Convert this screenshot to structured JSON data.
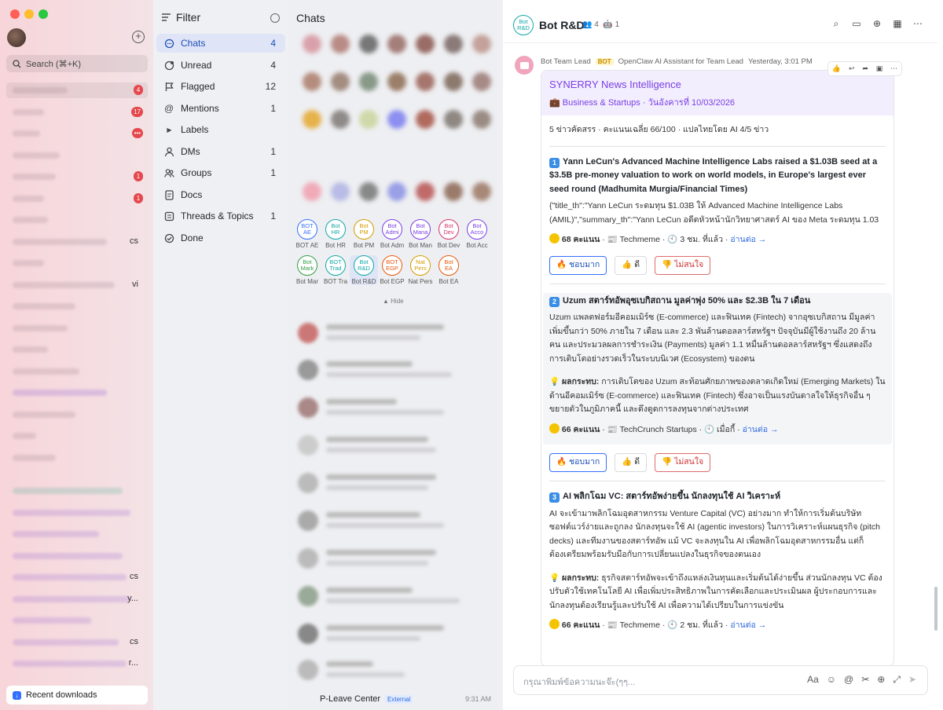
{
  "window": {
    "controls": [
      "close",
      "minimize",
      "zoom"
    ]
  },
  "sidebar": {
    "search_placeholder": "Search (⌘+K)",
    "badges": [
      "4",
      "17",
      "•••",
      "1",
      "1"
    ],
    "truncated_tails": [
      "cs",
      "vi",
      "cs",
      "cs",
      "y...",
      "cs",
      "r..."
    ],
    "recent_downloads": "Recent downloads"
  },
  "filter": {
    "title": "Filter",
    "items": [
      {
        "label": "Chats",
        "count": "4",
        "icon": "chat-bubble-icon"
      },
      {
        "label": "Unread",
        "count": "4",
        "icon": "unread-icon"
      },
      {
        "label": "Flagged",
        "count": "12",
        "icon": "flag-icon"
      },
      {
        "label": "Mentions",
        "count": "1",
        "icon": "at-icon"
      },
      {
        "label": "Labels",
        "count": "",
        "icon": "caret-right-icon"
      },
      {
        "label": "DMs",
        "count": "1",
        "icon": "person-icon"
      },
      {
        "label": "Groups",
        "count": "1",
        "icon": "group-icon"
      },
      {
        "label": "Docs",
        "count": "",
        "icon": "doc-icon"
      },
      {
        "label": "Threads & Topics",
        "count": "1",
        "icon": "threads-icon"
      },
      {
        "label": "Done",
        "count": "",
        "icon": "check-icon"
      }
    ]
  },
  "chats": {
    "title": "Chats",
    "bots": [
      {
        "avatar": [
          "BOT",
          "AE"
        ],
        "name": "BOT AE",
        "color": "#3370ff"
      },
      {
        "avatar": [
          "Bot",
          "HR"
        ],
        "name": "Bot HR",
        "color": "#13a8a8"
      },
      {
        "avatar": [
          "Bot",
          "PM"
        ],
        "name": "Bot PM",
        "color": "#d49b00"
      },
      {
        "avatar": [
          "Bot",
          "Admi"
        ],
        "name": "Bot Adm",
        "color": "#7b3fe4"
      },
      {
        "avatar": [
          "Bot",
          "Mana"
        ],
        "name": "Bot Man",
        "color": "#7b3fe4"
      },
      {
        "avatar": [
          "Bot",
          "Dev"
        ],
        "name": "Bot Dev",
        "color": "#d6336c"
      },
      {
        "avatar": [
          "Bot",
          "Acco"
        ],
        "name": "Bot Acc",
        "color": "#7b3fe4"
      },
      {
        "avatar": [
          "Bot",
          "Mark"
        ],
        "name": "Bot Mar",
        "color": "#2f9e44"
      },
      {
        "avatar": [
          "BOT",
          "Trad"
        ],
        "name": "BOT Tra",
        "color": "#13a8a8"
      },
      {
        "avatar": [
          "Bot",
          "R&D"
        ],
        "name": "Bot R&D",
        "color": "#13a8a8"
      },
      {
        "avatar": [
          "BOT",
          "EGP"
        ],
        "name": "Bot EGP",
        "color": "#e8590c"
      },
      {
        "avatar": [
          "Nat",
          "Pers"
        ],
        "name": "Nat Pers",
        "color": "#d49b00"
      },
      {
        "avatar": [
          "Bot",
          "EA"
        ],
        "name": "Bot EA",
        "color": "#e8590c"
      }
    ],
    "hide_label": "Hide",
    "last_row": {
      "name": "P-Leave Center",
      "tag": "External",
      "time": "9:31 AM"
    }
  },
  "conversation": {
    "avatar": [
      "Bot",
      "R&D"
    ],
    "title": "Bot R&D",
    "members": "4",
    "bots_count": "1",
    "message": {
      "sender": "Bot Team Lead",
      "sender_tag": "BOT",
      "sender_desc": "OpenClaw AI Assistant for Team Lead",
      "time": "Yesterday, 3:01 PM",
      "card_title": "SYNERRY News Intelligence",
      "card_subtitle": "💼 Business & Startups · วันอังคารที่ 10/03/2026",
      "summary": "5 ข่าวคัดสรร · คะแนนเฉลี่ย 66/100 · แปลไทยโดย AI 4/5 ข่าว",
      "items": [
        {
          "num": "1",
          "headline": "Yann LeCun's Advanced Machine Intelligence Labs raised a $1.03B seed at a $3.5B pre-money valuation to work on world models, in Europe's largest ever seed round (Madhumita Murgia/Financial Times)",
          "body": "{\"title_th\":\"Yann LeCun ระดมทุน $1.03B ให้ Advanced Machine Intelligence Labs (AMIL)\",\"summary_th\":\"Yann LeCun อดีตหัวหน้านักวิทยาศาสตร์ AI ของ Meta ระดมทุน 1.03",
          "impact": "",
          "score": "68 คะแนน",
          "source": "📰 Techmeme",
          "when": "🕙 3 ชม. ที่แล้ว",
          "link": "อ่านต่อ →"
        },
        {
          "num": "2",
          "headline": "Uzum สตาร์ทอัพอุซเบกิสถาน มูลค่าพุ่ง 50% และ $2.3B ใน 7 เดือน",
          "body": "Uzum แพลตฟอร์มอีคอมเมิร์ซ (E-commerce) และฟินเทค (Fintech) จากอุซเบกิสถาน มีมูลค่าเพิ่มขึ้นกว่า 50% ภายใน 7 เดือน และ 2.3 พันล้านดอลลาร์สหรัฐฯ ปัจจุบันมีผู้ใช้งานถึง 20 ล้านคน และประมวลผลการชำระเงิน (Payments) มูลค่า 1.1 หมื่นล้านดอลลาร์สหรัฐฯ ซึ่งแสดงถึงการเติบโตอย่างรวดเร็วในระบบนิเวศ (Ecosystem) ของตน",
          "impact_label": "ผลกระทบ:",
          "impact": "การเติบโตของ Uzum สะท้อนศักยภาพของตลาดเกิดใหม่ (Emerging Markets) ในด้านอีคอมเมิร์ซ (E-commerce) และฟินเทค (Fintech) ซึ่งอาจเป็นแรงบันดาลใจให้ธุรกิจอื่น ๆ ขยายตัวในภูมิภาคนี้ และดึงดูดการลงทุนจากต่างประเทศ",
          "score": "66 คะแนน",
          "source": "📰 TechCrunch Startups",
          "when": "🕙 เมื่อกี้",
          "link": "อ่านต่อ →"
        },
        {
          "num": "3",
          "headline": "AI พลิกโฉม VC: สตาร์ทอัพง่ายขึ้น นักลงทุนใช้ AI วิเคราะห์",
          "body": "AI จะเข้ามาพลิกโฉมอุตสาหกรรม Venture Capital (VC) อย่างมาก ทำให้การเริ่มต้นบริษัทซอฟต์แวร์ง่ายและถูกลง นักลงทุนจะใช้ AI (agentic investors) ในการวิเคราะห์แผนธุรกิจ (pitch decks) และทีมงานของสตาร์ทอัพ แม้ VC จะลงทุนใน AI เพื่อพลิกโฉมอุตสาหกรรมอื่น แต่ก็ต้องเตรียมพร้อมรับมือกับการเปลี่ยนแปลงในธุรกิจของตนเอง",
          "impact_label": "ผลกระทบ:",
          "impact": "ธุรกิจสตาร์ทอัพจะเข้าถึงแหล่งเงินทุนและเริ่มต้นได้ง่ายขึ้น ส่วนนักลงทุน VC ต้องปรับตัวใช้เทคโนโลยี AI เพื่อเพิ่มประสิทธิภาพในการคัดเลือกและประเมินผล ผู้ประกอบการและนักลงทุนต้องเรียนรู้และปรับใช้ AI เพื่อความได้เปรียบในการแข่งขัน",
          "score": "66 คะแนน",
          "source": "📰 Techmeme",
          "when": "🕙 2 ชม. ที่แล้ว",
          "link": "อ่านต่อ →"
        }
      ],
      "reactions": {
        "love": "🔥 ชอบมาก",
        "like": "👍 ดี",
        "dislike": "👎 ไม่สนใจ"
      }
    },
    "composer_placeholder": "กรุณาพิมพ์ข้อความนะจ๊ะ(ๆๆ..."
  },
  "colors": {
    "accent": "#3370ff",
    "card_title": "#7b3fe4",
    "badge": "#e5484d"
  }
}
